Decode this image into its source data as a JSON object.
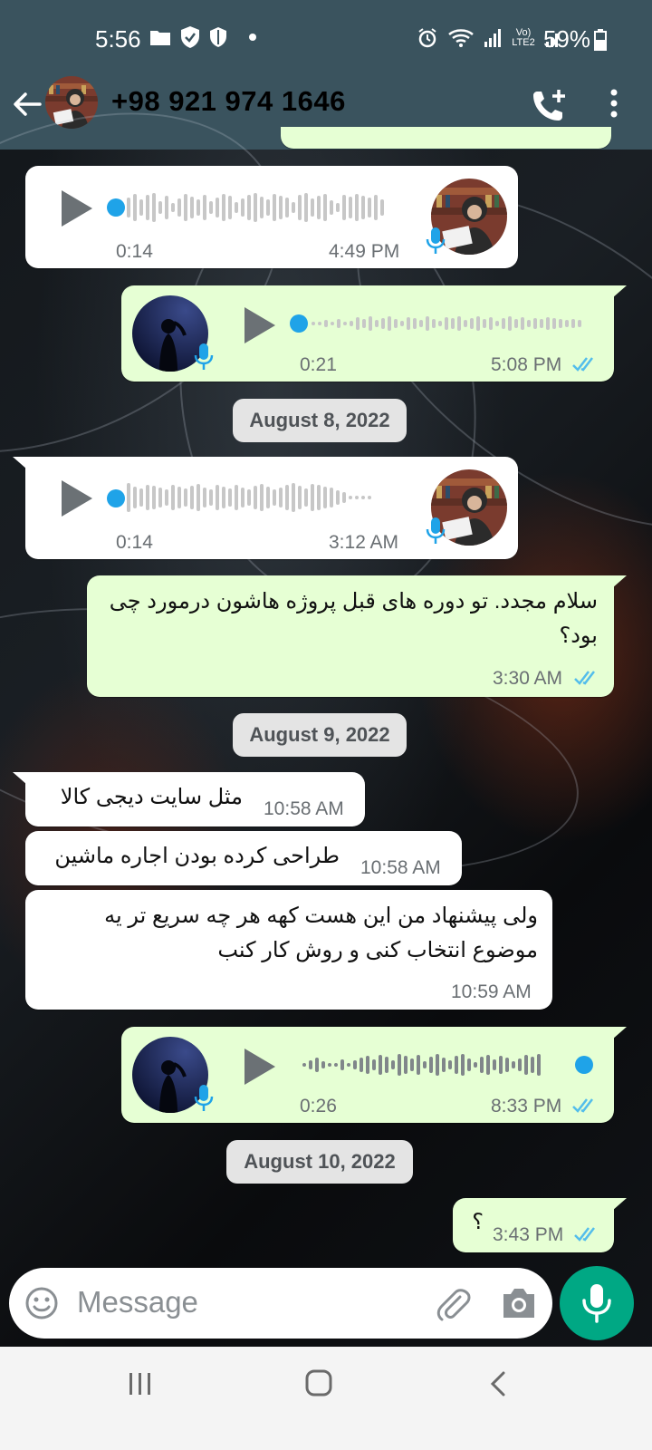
{
  "status_bar": {
    "time": "5:56",
    "battery": "59%",
    "signal_label": "Vo) LTE2"
  },
  "header": {
    "contact": "+98 921 974 1646"
  },
  "messages": {
    "v1": {
      "duration": "0:14",
      "time": "4:49 PM"
    },
    "v2": {
      "duration": "0:21",
      "time": "5:08 PM"
    },
    "date1": "August 8, 2022",
    "v3": {
      "duration": "0:14",
      "time": "3:12 AM"
    },
    "t1": {
      "text": "سلام مجدد. تو دوره های قبل پروژه هاشون درمورد چی بود؟",
      "time": "3:30 AM"
    },
    "date2": "August 9, 2022",
    "t2": {
      "text": "مثل سایت دیجی کالا",
      "time": "10:58 AM"
    },
    "t3": {
      "text": "طراحی کرده بودن اجاره ماشین",
      "time": "10:58 AM"
    },
    "t4": {
      "text": "ولی پیشنهاد من این هست کهه هر چه سریع تر یه موضوع انتخاب کنی و روش کار کنب",
      "time": "10:59 AM"
    },
    "v4": {
      "duration": "0:26",
      "time": "8:33 PM"
    },
    "date3": "August 10, 2022",
    "t5": {
      "text": "؟",
      "time": "3:43 PM"
    }
  },
  "input": {
    "placeholder": "Message"
  },
  "colors": {
    "header": "#3a535e",
    "incoming_bubble": "#ffffff",
    "outgoing_bubble": "#e6ffd4",
    "accent_green": "#00a884",
    "read_ticks": "#53bdeb",
    "voice_dot": "#1fa3e8"
  },
  "icons": [
    "back-arrow-icon",
    "add-call-icon",
    "more-vert-icon",
    "play-icon",
    "mic-icon",
    "double-check-icon",
    "emoji-icon",
    "attach-icon",
    "camera-icon",
    "recents-icon",
    "home-icon",
    "nav-back-icon"
  ]
}
